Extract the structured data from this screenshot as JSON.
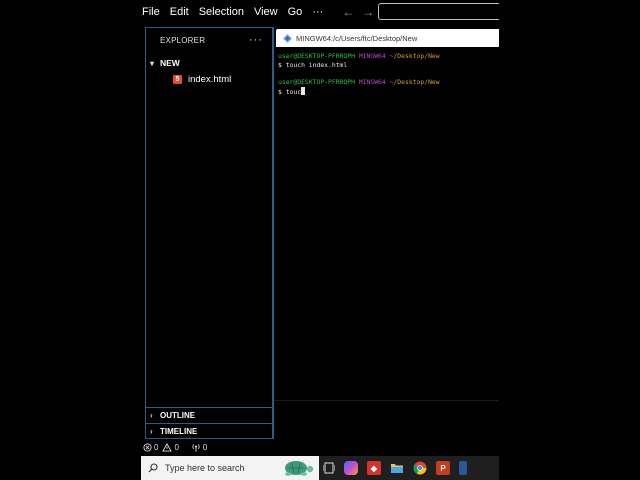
{
  "menubar": {
    "items": [
      "File",
      "Edit",
      "Selection",
      "View",
      "Go",
      "···"
    ],
    "back_icon": "arrow-left-icon",
    "forward_icon": "arrow-right-icon"
  },
  "explorer": {
    "title": "EXPLORER",
    "more_label": "···",
    "folder": "NEW",
    "files": [
      "index.html"
    ],
    "outline_label": "OUTLINE",
    "timeline_label": "TIMELINE"
  },
  "terminal": {
    "tab_title": "MINGW64:/c/Users/ftc/Desktop/New",
    "entries": [
      {
        "user": "user@DESKTOP-PFRRQPH",
        "host": "MINGW64",
        "path": "~/Desktop/New",
        "command": "$ touch index.html"
      },
      {
        "user": "user@DESKTOP-PFRRQPH",
        "host": "MINGW64",
        "path": "~/Desktop/New",
        "command": "$ touc"
      }
    ]
  },
  "status": {
    "errors": "0",
    "warnings": "0",
    "ports": "0"
  },
  "taskbar": {
    "search_placeholder": "Type here to search"
  },
  "colors": {
    "panel_border": "#2a5d8a",
    "prompt_user": "#2fbf45",
    "prompt_host": "#b548c6",
    "prompt_path": "#c9a227",
    "html_icon": "#e44d26"
  }
}
